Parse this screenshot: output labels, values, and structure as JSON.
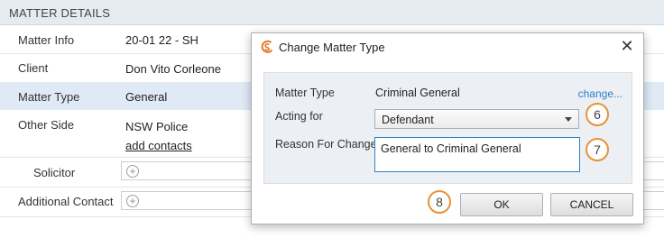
{
  "section": {
    "title": "MATTER DETAILS"
  },
  "rows": {
    "matter_info": {
      "label": "Matter Info",
      "value": "20-01 22 - SH"
    },
    "client": {
      "label": "Client",
      "value": "Don Vito Corleone"
    },
    "matter_type": {
      "label": "Matter Type",
      "value": "General"
    },
    "other_side": {
      "label": "Other Side",
      "value": "NSW Police",
      "link": "add contacts"
    },
    "solicitor": {
      "label": "Solicitor"
    },
    "additional_contact": {
      "label": "Additional Contact"
    }
  },
  "dialog": {
    "title": "Change Matter Type",
    "close_glyph": "✕",
    "matter_type_label": "Matter Type",
    "matter_type_value": "Criminal General",
    "change_link": "change...",
    "acting_for_label": "Acting for",
    "acting_for_value": "Defendant",
    "reason_label": "Reason For Change",
    "reason_value": "General to Criminal General",
    "ok_label": "OK",
    "cancel_label": "CANCEL"
  },
  "badges": {
    "acting_for": "6",
    "reason": "7",
    "ok": "8"
  },
  "colors": {
    "highlight_row": "#dfeaf6",
    "link_blue": "#2e7fc8",
    "badge_orange": "#e8923a",
    "focus_blue": "#2f7fcc"
  },
  "icons": {
    "add": "plus-circle-icon",
    "logo": "app-logo-icon",
    "close": "close-icon",
    "dropdown": "chevron-down-icon"
  }
}
